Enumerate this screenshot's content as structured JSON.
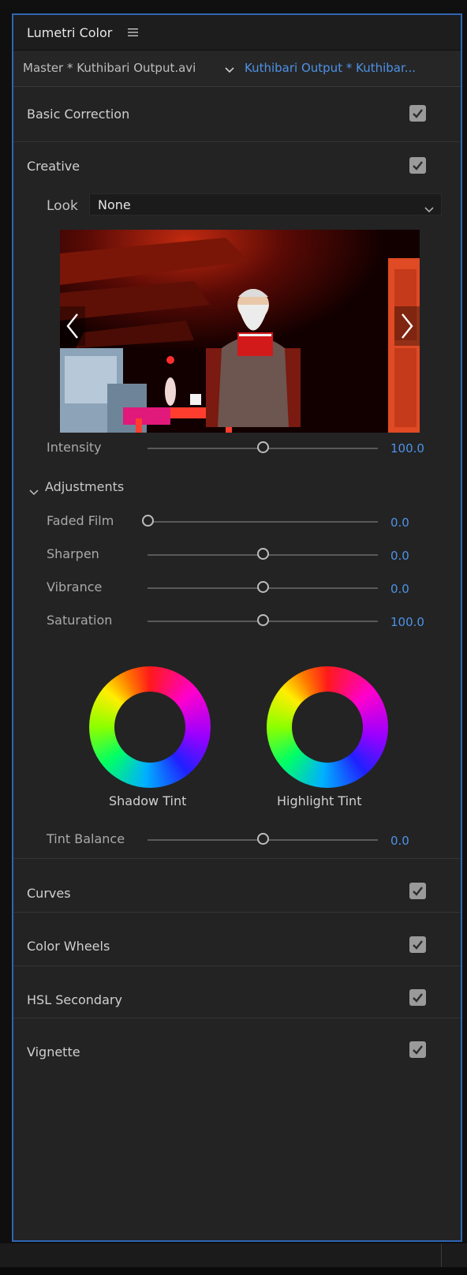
{
  "panel": {
    "title": "Lumetri Color",
    "menu_icon": "hamburger-menu-icon",
    "accent_color": "#4e92e6",
    "border_color": "#2f66b2"
  },
  "clip_selector": {
    "master_label": "Master * Kuthibari Output.avi",
    "active_label": "Kuthibari Output * Kuthibar..."
  },
  "sections": {
    "basic_correction": {
      "label": "Basic Correction",
      "checked": true
    },
    "creative": {
      "label": "Creative",
      "checked": true
    },
    "curves": {
      "label": "Curves",
      "checked": true
    },
    "color_wheels": {
      "label": "Color Wheels",
      "checked": true
    },
    "hsl_secondary": {
      "label": "HSL Secondary",
      "checked": true
    },
    "vignette": {
      "label": "Vignette",
      "checked": true
    }
  },
  "creative": {
    "look_label": "Look",
    "look_value": "None",
    "intensity": {
      "label": "Intensity",
      "value": "100.0",
      "fraction": 0.5
    },
    "adjustments_label": "Adjustments",
    "faded_film": {
      "label": "Faded Film",
      "value": "0.0",
      "fraction": 0.0
    },
    "sharpen": {
      "label": "Sharpen",
      "value": "0.0",
      "fraction": 0.5
    },
    "vibrance": {
      "label": "Vibrance",
      "value": "0.0",
      "fraction": 0.5
    },
    "saturation": {
      "label": "Saturation",
      "value": "100.0",
      "fraction": 0.5
    },
    "shadow_tint_label": "Shadow Tint",
    "highlight_tint_label": "Highlight Tint",
    "tint_balance": {
      "label": "Tint Balance",
      "value": "0.0",
      "fraction": 0.5
    }
  }
}
